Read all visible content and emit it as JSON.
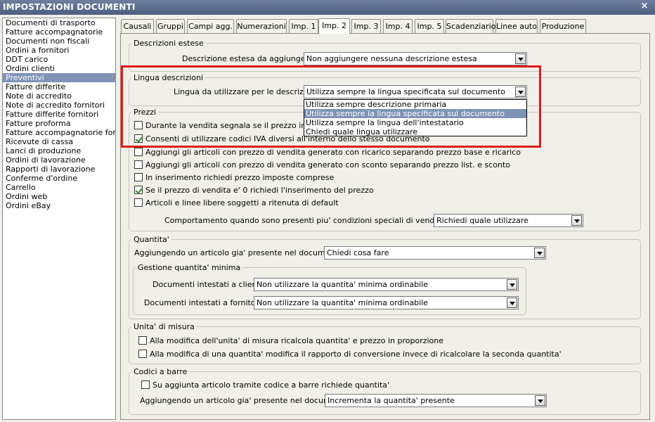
{
  "window": {
    "title": "IMPOSTAZIONI DOCUMENTI",
    "close_label": "×"
  },
  "sidebar": {
    "items": [
      "Documenti di trasporto",
      "Fatture accompagnatorie",
      "Documenti non fiscali",
      "Ordini a fornitori",
      "DDT carico",
      "Ordini clienti",
      "Preventivi",
      "Fatture differite",
      "Note di accredito",
      "Note di accredito fornitori",
      "Fatture differite fornitori",
      "Fatture proforma",
      "Fatture accompagnatorie fornito",
      "Ricevute di cassa",
      "Lanci di produzione",
      "Ordini di lavorazione",
      "Rapporti di lavorazione",
      "Conferme d'ordine",
      "Carrello",
      "Ordini web",
      "Ordini eBay"
    ],
    "selected": "Preventivi"
  },
  "tabs": [
    "Causali",
    "Gruppi",
    "Campi agg.",
    "Numerazioni",
    "Imp. 1",
    "Imp. 2",
    "Imp. 3",
    "Imp. 4",
    "Imp. 5",
    "Scadenziario",
    "Linee auto",
    "Produzione"
  ],
  "active_tab": "Imp. 2",
  "descrizioni_estese": {
    "legend": "Descrizioni estese",
    "label": "Descrizione estesa da aggiungere :",
    "value": "Non aggiungere nessuna descrizione estesa"
  },
  "lingua_descrizioni": {
    "legend": "Lingua descrizioni",
    "label": "Lingua da utilizzare per le descrizioni :",
    "value": "Utilizza sempre la lingua specificata sul documento",
    "options": [
      "Utilizza sempre descrizione primaria",
      "Utilizza sempre la lingua specificata sul documento",
      "Utilizza sempre la lingua dell'intestatario",
      "Chiedi quale lingua utilizzare"
    ]
  },
  "prezzi": {
    "legend": "Prezzi",
    "checks": [
      {
        "label": "Durante la vendita segnala se il prezzo indicato",
        "checked": false
      },
      {
        "label": "Consenti di utilizzare codici IVA diversi all'interno dello stesso documento",
        "checked": true
      },
      {
        "label": "Aggiungi gli articoli con prezzo di vendita generato con ricarico separando prezzo base e ricarico",
        "checked": false
      },
      {
        "label": "Aggiungi gli articoli con prezzo di vendita generato con sconto separando prezzo list. e sconto",
        "checked": false
      },
      {
        "label": "In inserimento richiedi prezzo imposte comprese",
        "checked": false
      },
      {
        "label": "Se il prezzo di vendita e' 0 richiedi l'inserimento del prezzo",
        "checked": true
      },
      {
        "label": "Articoli e linee libere soggetti a ritenuta di default",
        "checked": false
      }
    ],
    "condizioni_label": "Comportamento quando sono presenti piu' condizioni speciali di vendita valide :",
    "condizioni_value": "Richiedi quale utilizzare"
  },
  "quantita": {
    "legend": "Quantita'",
    "label": "Aggiungendo un articolo gia' presente nel documento :",
    "value": "Chiedi cosa fare",
    "minima": {
      "legend": "Gestione quantita' minima",
      "clienti_label": "Documenti intestati a clienti :",
      "clienti_value": "Non utilizzare la quantita' minima ordinabile",
      "fornitori_label": "Documenti intestati a fornitori :",
      "fornitori_value": "Non utilizzare la quantita' minima ordinabile"
    }
  },
  "unita_misura": {
    "legend": "Unita' di misura",
    "checks": [
      {
        "label": "Alla modifica dell'unita' di misura ricalcola quantita' e prezzo in proporzione",
        "checked": false
      },
      {
        "label": "Alla modifica di una quantita' modifica il rapporto di conversione invece di ricalcolare la seconda quantita'",
        "checked": false
      }
    ]
  },
  "codici_barre": {
    "legend": "Codici a barre",
    "check": {
      "label": "Su aggiunta articolo tramite codice a barre richiede quantita'",
      "checked": false
    },
    "label": "Aggiungendo un articolo gia' presente nel documento :",
    "value": "Incrementa la quantita' presente"
  }
}
